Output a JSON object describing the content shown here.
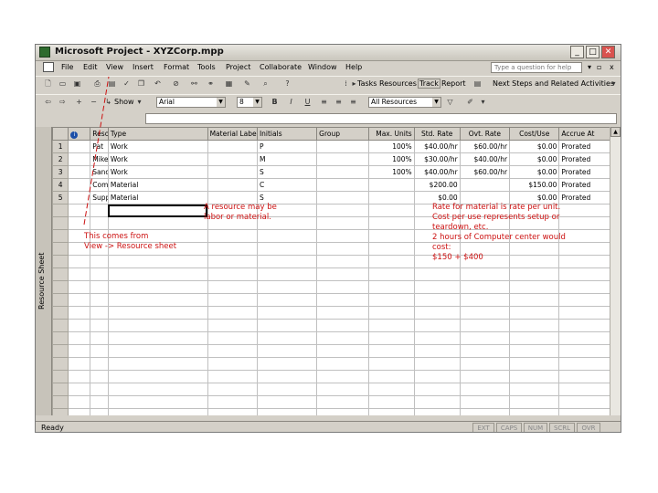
{
  "window": {
    "title": "Microsoft Project - XYZCorp.mpp",
    "minimize": "_",
    "maximize": "□",
    "close": "✕"
  },
  "menubar": {
    "items": [
      "File",
      "Edit",
      "View",
      "Insert",
      "Format",
      "Tools",
      "Project",
      "Collaborate",
      "Window",
      "Help"
    ],
    "help_placeholder": "Type a question for help",
    "close_doc": "x"
  },
  "toolbar1": {
    "tasks": "Tasks",
    "resources": "Resources",
    "track": "Track",
    "report": "Report",
    "next_steps": "Next Steps and Related Activities"
  },
  "toolbar2": {
    "show": "Show",
    "font": "Arial",
    "font_size": "8",
    "bold": "B",
    "italic": "I",
    "underline": "U",
    "filter": "All Resources"
  },
  "sheet": {
    "side_label": "Resource Sheet",
    "columns": [
      "",
      "",
      "Resource Name",
      "Type",
      "Material Label",
      "Initials",
      "Group",
      "Max. Units",
      "Std. Rate",
      "Ovt. Rate",
      "Cost/Use",
      "Accrue At"
    ],
    "rows": [
      [
        "1",
        "",
        "Pat",
        "Work",
        "",
        "P",
        "",
        "100%",
        "$40.00/hr",
        "$60.00/hr",
        "$0.00",
        "Prorated"
      ],
      [
        "2",
        "",
        "Mike",
        "Work",
        "",
        "M",
        "",
        "100%",
        "$30.00/hr",
        "$40.00/hr",
        "$0.00",
        "Prorated"
      ],
      [
        "3",
        "",
        "Sandy",
        "Work",
        "",
        "S",
        "",
        "100%",
        "$40.00/hr",
        "$60.00/hr",
        "$0.00",
        "Prorated"
      ],
      [
        "4",
        "",
        "Computer center hour",
        "Material",
        "",
        "C",
        "",
        "",
        "$200.00",
        "",
        "$150.00",
        "Prorated"
      ],
      [
        "5",
        "",
        "Supplies",
        "Material",
        "",
        "S",
        "",
        "",
        "$0.00",
        "",
        "$0.00",
        "Prorated"
      ]
    ]
  },
  "status": {
    "ready": "Ready",
    "panels": [
      "EXT",
      "CAPS",
      "NUM",
      "SCRL",
      "OVR"
    ]
  },
  "annotations": {
    "from_view_1": "This comes from",
    "from_view_2": "View -> Resource sheet",
    "labor_1": "A resource may be",
    "labor_2": "labor or material.",
    "rate_1": "Rate for material is rate per unit.",
    "rate_2": "Cost per use represents setup or",
    "rate_3": "teardown, etc.",
    "rate_4": "2 hours of Computer center would",
    "rate_5": "cost:",
    "rate_6": "$150 + $400"
  },
  "colors": {
    "annotation": "#cc1111",
    "chrome": "#d4d0c8"
  }
}
